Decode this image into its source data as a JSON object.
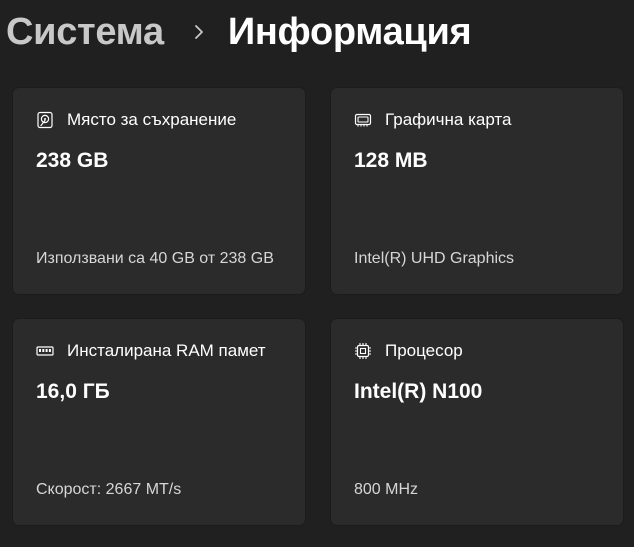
{
  "breadcrumb": {
    "parent": "Система",
    "current": "Информация"
  },
  "cards": {
    "storage": {
      "icon": "hard-drive-icon",
      "label": "Място за съхранение",
      "value": "238 GB",
      "detail": "Използвани са 40 GB от 238 GB"
    },
    "gpu": {
      "icon": "graphics-card-icon",
      "label": "Графична карта",
      "value": "128 MB",
      "detail": "Intel(R) UHD Graphics"
    },
    "ram": {
      "icon": "memory-icon",
      "label": "Инсталирана RAM памет",
      "value": "16,0 ГБ",
      "detail": "Скорост: 2667 MT/s"
    },
    "cpu": {
      "icon": "processor-icon",
      "label": "Процесор",
      "value": "Intel(R) N100",
      "detail": "800 MHz"
    }
  },
  "colors": {
    "background": "#202020",
    "card": "#2b2b2b",
    "parent_text": "#c8c8c8",
    "text": "#ffffff",
    "secondary_text": "#d6d6d6"
  }
}
